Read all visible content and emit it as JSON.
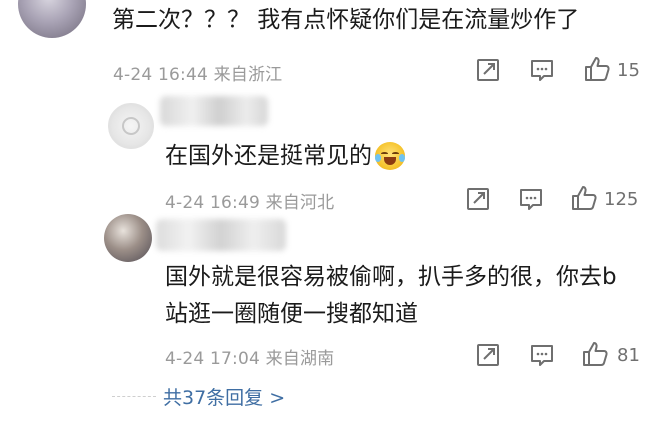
{
  "comments": [
    {
      "text": "第二次？？？ 我有点怀疑你们是在流量炒作了",
      "meta": "4-24 16:44  来自浙江",
      "likes": "15"
    },
    {
      "text": "在国外还是挺常见的",
      "emoji": "laugh-cry-emoji",
      "meta": "4-24 16:49  来自河北",
      "likes": "125"
    },
    {
      "text": "国外就是很容易被偷啊，扒手多的很，你去b站逛一圈随便一搜都知道",
      "meta": "4-24 17:04  来自湖南",
      "likes": "81"
    }
  ],
  "footer": {
    "replies_label": "共37条回复 >"
  },
  "colors": {
    "meta": "#9a9a9a",
    "link": "#3f6ea3",
    "icon": "#6f6f6f"
  }
}
